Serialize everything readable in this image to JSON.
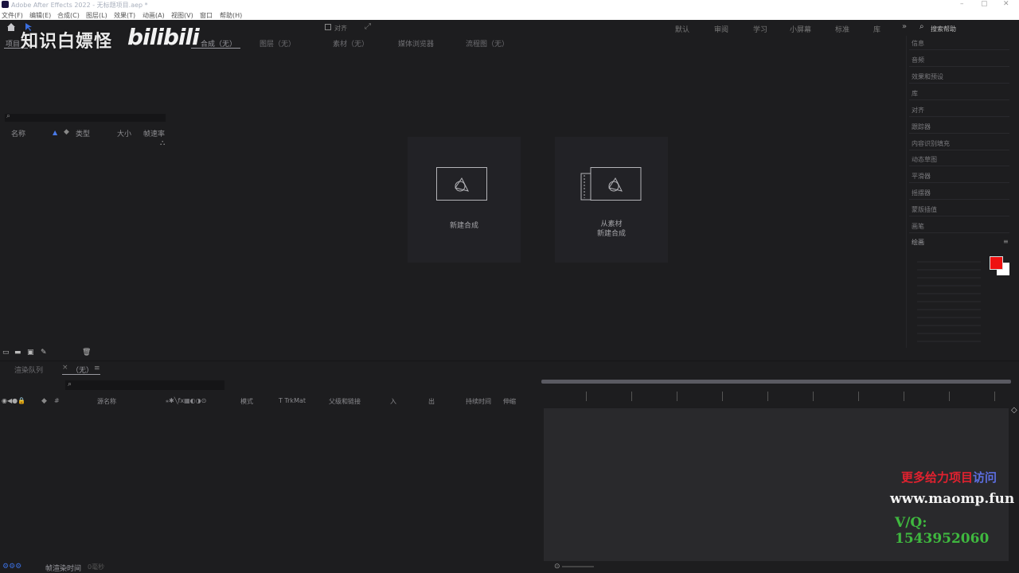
{
  "window": {
    "title": "Adobe After Effects 2022 - 无标题项目.aep *"
  },
  "menu": [
    "文件(F)",
    "编辑(E)",
    "合成(C)",
    "图层(L)",
    "效果(T)",
    "动画(A)",
    "视图(V)",
    "窗口",
    "帮助(H)"
  ],
  "toolbar": {
    "snap_label": "对齐"
  },
  "workspaces": [
    "默认",
    "审阅",
    "学习",
    "小屏幕",
    "标准",
    "库"
  ],
  "search_help": "搜索帮助",
  "watermark": {
    "channel": "知识白嫖怪",
    "site": "bilibili"
  },
  "tabs": {
    "project": "项目",
    "composition": "合成（无）",
    "layer": "图层（无）",
    "footage": "素材（无）",
    "media_browser": "媒体浏览器",
    "flowchart": "流程图（无）"
  },
  "project_columns": {
    "name": "名称",
    "type": "类型",
    "size": "大小",
    "fps": "帧速率"
  },
  "comp_cards": {
    "new": "新建合成",
    "from_footage_1": "从素材",
    "from_footage_2": "新建合成"
  },
  "right_panel": [
    "信息",
    "音频",
    "效果和预设",
    "库",
    "对齐",
    "跟踪器",
    "内容识别填充",
    "动态草图",
    "平滑器",
    "摇摆器",
    "蒙版插值",
    "画笔",
    "绘画"
  ],
  "colors": {
    "foreground": "#ee1111",
    "background": "#ffffff"
  },
  "timeline": {
    "render_queue_tab": "渲染队列",
    "comp_tab": "（无）",
    "headers": {
      "source_name": "源名称",
      "mode": "模式",
      "trkmat": "T  TrkMat",
      "parent": "父级和链接",
      "in": "入",
      "out": "出",
      "duration": "持续时间",
      "stretch": "伸缩"
    },
    "render_time_label": "帧渲染时间",
    "render_time_value": "0毫秒"
  },
  "ad": {
    "line1_red": "更多给力项目",
    "line1_blue": "访问",
    "line2": "www.maomp.fun",
    "line3": "V/Q:  1543952060"
  }
}
